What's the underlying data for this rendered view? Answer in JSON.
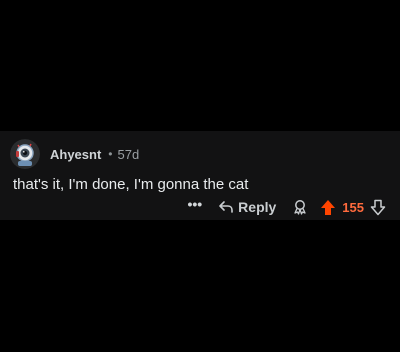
{
  "comment": {
    "author": "Ahyesnt",
    "separator": "•",
    "age": "57d",
    "text": "that's it, I'm done, I'm gonna the cat"
  },
  "actions": {
    "more_label": "•••",
    "reply_label": "Reply",
    "score": "155"
  },
  "colors": {
    "upvote_active": "#ff4500",
    "score": "#ff6a3d",
    "card_background": "#121213"
  },
  "icons": {
    "avatar": "avatar-robot-icon",
    "reply": "reply-arrow-icon",
    "award": "award-icon",
    "upvote": "upvote-arrow-icon",
    "downvote": "downvote-arrow-icon"
  }
}
